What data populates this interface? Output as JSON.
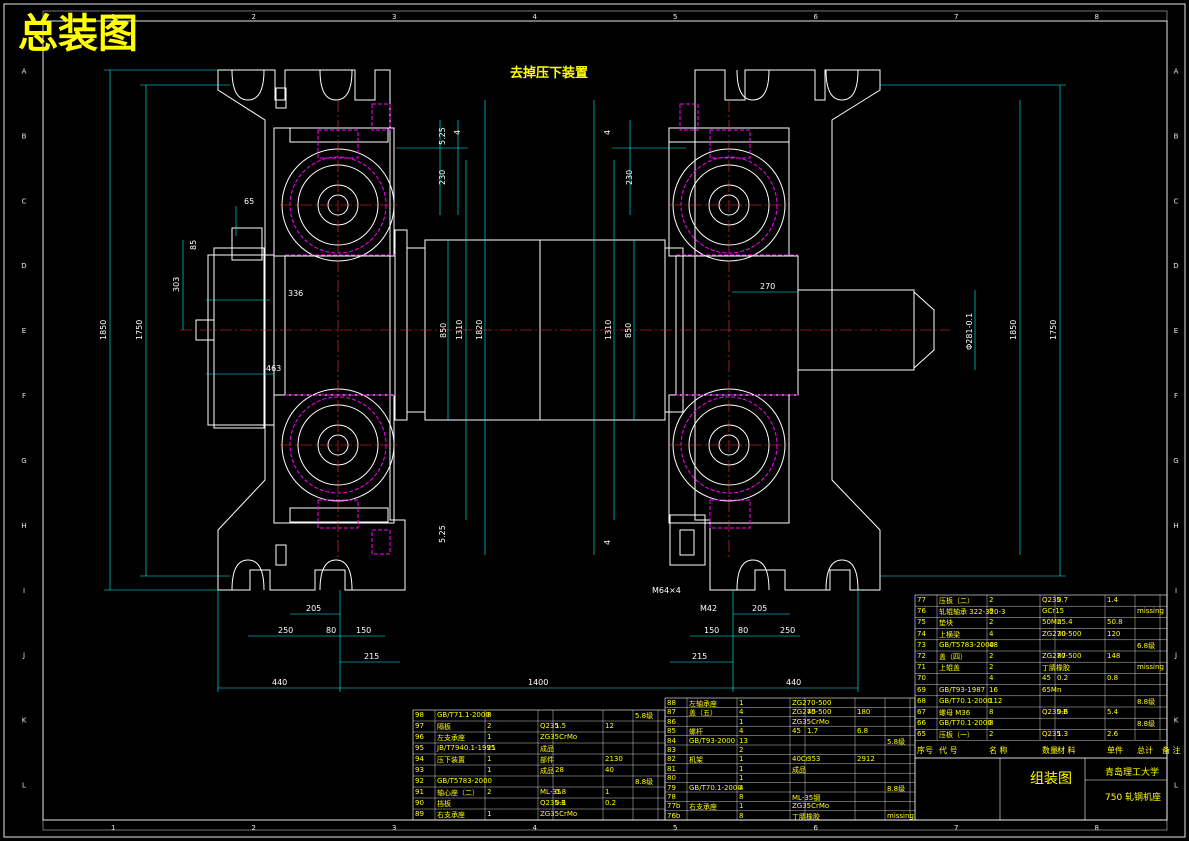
{
  "drawing": {
    "main_title": "总装图",
    "sub_title": "去掉压下装置",
    "colors": {
      "border": "#e6e6e6",
      "outline": "#ffffff",
      "dimension": "#00ffff",
      "hidden": "#ff00ff",
      "centerline": "#ff3333",
      "text": "#ffff00"
    },
    "frame": {
      "columns": [
        "1",
        "2",
        "3",
        "4",
        "5",
        "6",
        "7",
        "8"
      ],
      "rows": [
        "A",
        "B",
        "C",
        "D",
        "E",
        "F",
        "G",
        "H",
        "I",
        "J",
        "K",
        "L"
      ]
    },
    "dimensions": {
      "left_total_height": "1850",
      "left_inner_height": "1750",
      "left_303": "303",
      "left_85": "85",
      "left_65": "65",
      "left_336": "336",
      "left_463": "463",
      "top_525": "5.25",
      "top_4": "4",
      "top_230": "230",
      "mid_850": "850",
      "mid_1310": "1310",
      "mid_1820": "1820",
      "right_1310": "1310",
      "right_850": "850",
      "right_230": "230",
      "right_4": "4",
      "right_270": "270",
      "right_shaft": "Φ281-0.1",
      "right_1850": "1850",
      "right_1750": "1750",
      "bot_525": "5.25",
      "bot_4": "4",
      "left_205": "205",
      "left_250": "250",
      "left_80": "80",
      "left_150": "150",
      "left_215": "215",
      "left_440": "440",
      "center_1400": "1400",
      "right_440": "440",
      "right_205": "205",
      "right_150": "150",
      "right_80": "80",
      "right_250": "250",
      "right_215": "215",
      "m64": "M64×4",
      "m42": "M42"
    },
    "title_block": {
      "school": "青岛理工大学",
      "drawing_name": "组装图",
      "product": "750 轧钢机座",
      "header_labels": [
        "序号",
        "代 号",
        "名 称",
        "数量",
        "材 料",
        "单件",
        "总计",
        "备 注"
      ]
    },
    "parts_right": [
      [
        "77",
        "压板（二）",
        "2",
        "Q235",
        "0.7",
        "1.4",
        ""
      ],
      [
        "76",
        "轧辊轴承 322-320-3",
        "8",
        "GCr15",
        "",
        "",
        "missing"
      ],
      [
        "75",
        "垫块",
        "2",
        "50Mn",
        "25.4",
        "50.8",
        ""
      ],
      [
        "74",
        "上横梁",
        "4",
        "ZG270-500",
        "30",
        "120",
        ""
      ],
      [
        "73",
        "GB/T5783-2000",
        "48",
        "",
        "",
        "",
        "6.8级"
      ],
      [
        "72",
        "盖（四）",
        "2",
        "ZG270-500",
        "87",
        "148",
        ""
      ],
      [
        "71",
        "上辊盖",
        "2",
        "丁腈橡胶",
        "",
        "",
        "missing"
      ],
      [
        "70",
        "",
        "4",
        "45",
        "0.2",
        "0.8",
        ""
      ],
      [
        "69",
        "GB/T93-1987",
        "16",
        "65Mn",
        "",
        "",
        ""
      ],
      [
        "68",
        "GB/T70.1-2000",
        "112",
        "",
        "",
        "",
        "8.8级"
      ],
      [
        "67",
        "螺母 M36",
        "8",
        "Q235-B",
        "0.6",
        "5.4",
        ""
      ],
      [
        "66",
        "GB/T70.1-2000",
        "8",
        "",
        "",
        "",
        "8.8级"
      ],
      [
        "65",
        "压板（一）",
        "2",
        "Q235",
        "1.3",
        "2.6",
        ""
      ]
    ],
    "parts_mid": [
      [
        "88",
        "左轴承座",
        "1",
        "ZG270-500",
        "",
        "",
        ""
      ],
      [
        "87",
        "盖（五）",
        "4",
        "ZG270-500",
        "45",
        "180",
        ""
      ],
      [
        "86",
        "",
        "1",
        "ZG35CrMo",
        "",
        "",
        ""
      ],
      [
        "85",
        "螺杆",
        "4",
        "45",
        "1.7",
        "6.8",
        ""
      ],
      [
        "84",
        "GB/T93-2000",
        "13",
        "",
        "",
        "",
        "5.8级"
      ],
      [
        "83",
        "",
        "2",
        "",
        "",
        "",
        ""
      ],
      [
        "82",
        "机架",
        "1",
        "40Cr",
        "353",
        "2912",
        ""
      ],
      [
        "81",
        "",
        "1",
        "成品",
        "",
        "",
        ""
      ],
      [
        "80",
        "",
        "1",
        "",
        "",
        "",
        ""
      ],
      [
        "79",
        "GB/T70.1-2000",
        "4",
        "",
        "",
        "",
        "8.8级"
      ],
      [
        "78",
        "",
        "8",
        "ML-35钢",
        "",
        "",
        ""
      ],
      [
        "77b",
        "右支承座",
        "1",
        "ZG35CrMo",
        "",
        "",
        ""
      ],
      [
        "76b",
        "",
        "8",
        "丁腈橡胶",
        "",
        "",
        "missing"
      ]
    ],
    "parts_left": [
      [
        "98",
        "GB/T71.1-2000",
        "8",
        "",
        "",
        "",
        "5.8级"
      ],
      [
        "97",
        "隔板",
        "2",
        "Q235",
        "1.5",
        "12",
        ""
      ],
      [
        "96",
        "左支承座",
        "1",
        "ZG35CrMo",
        "",
        "",
        ""
      ],
      [
        "95",
        "JB/T7940.1-1995",
        "21",
        "成品",
        "",
        "",
        ""
      ],
      [
        "94",
        "压下装置",
        "1",
        "部件",
        "",
        "2130",
        ""
      ],
      [
        "93",
        "",
        "1",
        "成品",
        "28",
        "40",
        ""
      ],
      [
        "92",
        "GB/T5783-2000",
        "",
        "",
        "",
        "",
        "8.8级"
      ],
      [
        "91",
        "轴心座（二）",
        "2",
        "ML-35",
        "0.8",
        "1",
        ""
      ],
      [
        "90",
        "挡板",
        "",
        "Q235-B",
        "0.1",
        "0.2",
        ""
      ],
      [
        "89",
        "右支承座",
        "1",
        "ZG35CrMo",
        "",
        "",
        ""
      ]
    ]
  }
}
